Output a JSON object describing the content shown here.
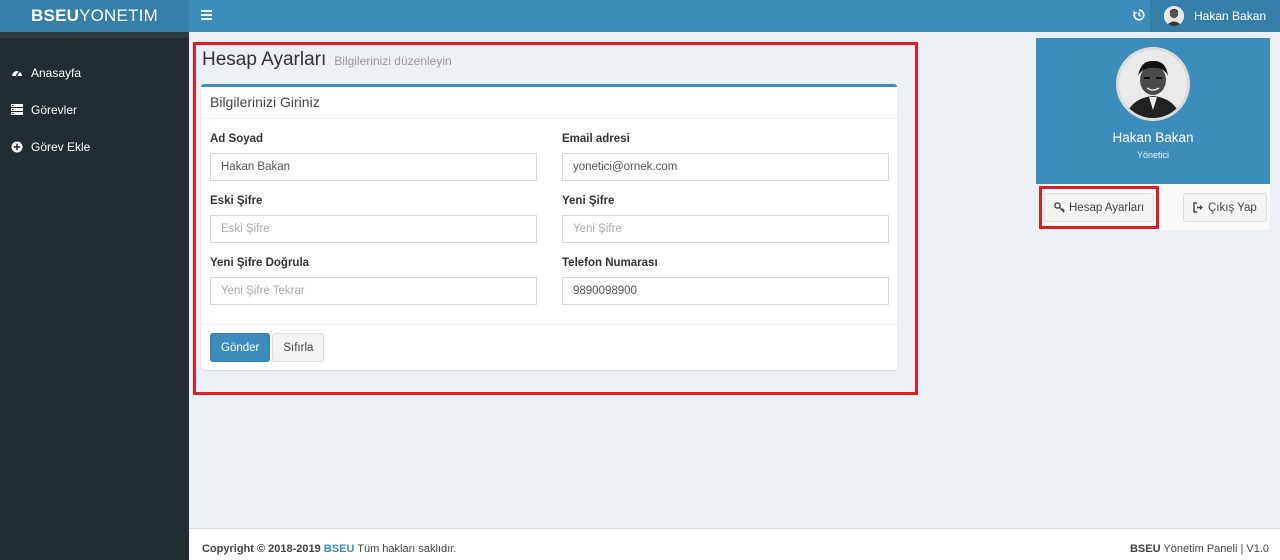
{
  "header": {
    "logo_bold": "BSEU",
    "logo_rest": "YONETIM",
    "user_name": "Hakan Bakan"
  },
  "sidebar": {
    "items": [
      {
        "label": "Anasayfa",
        "icon": "dashboard-icon"
      },
      {
        "label": "Görevler",
        "icon": "list-icon"
      },
      {
        "label": "Görev Ekle",
        "icon": "plus-circle-icon"
      }
    ]
  },
  "page": {
    "title": "Hesap Ayarları",
    "subtitle": "Bilgilerinizi düzenleyin"
  },
  "form": {
    "title": "Bilgilerinizi Giriniz",
    "fields": {
      "fullname": {
        "label": "Ad Soyad",
        "value": "Hakan Bakan",
        "placeholder": ""
      },
      "email": {
        "label": "Email adresi",
        "value": "yonetici@ornek.com",
        "placeholder": ""
      },
      "old_password": {
        "label": "Eski Şifre",
        "value": "",
        "placeholder": "Eski Şifre"
      },
      "new_password": {
        "label": "Yeni Şifre",
        "value": "",
        "placeholder": "Yeni Şifre"
      },
      "confirm_password": {
        "label": "Yeni Şifre Doğrula",
        "value": "",
        "placeholder": "Yeni Şifre Tekrar"
      },
      "phone": {
        "label": "Telefon Numarası",
        "value": "9890098900",
        "placeholder": ""
      }
    },
    "submit_label": "Gönder",
    "reset_label": "Sıfırla"
  },
  "profile": {
    "name": "Hakan Bakan",
    "role": "Yönetici",
    "settings_label": "Hesap Ayarları",
    "logout_label": "Çıkış Yap"
  },
  "footer": {
    "copyright_label": "Copyright © 2018-2019",
    "brand": "BSEU",
    "rights": "Tüm hakları saklıdır.",
    "right_brand": "BSEU",
    "right_text": "Yönetim Paneli | V1.0"
  },
  "colors": {
    "primary": "#3c8dbc",
    "primary_dark": "#367fa9",
    "sidebar": "#222d32",
    "background": "#ecf0f5",
    "annotation": "#e01c24"
  }
}
